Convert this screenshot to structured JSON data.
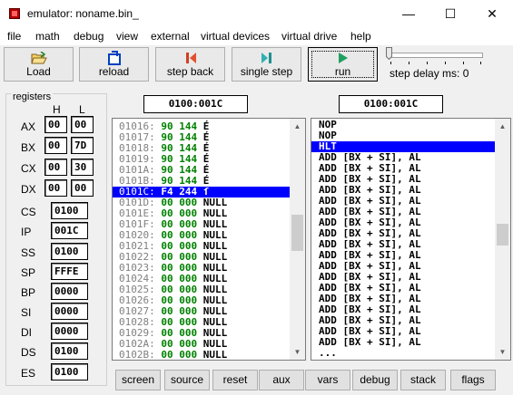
{
  "window": {
    "title": "emulator: noname.bin_",
    "minimize": "—",
    "maximize": "☐",
    "close": "✕"
  },
  "menu": [
    "file",
    "math",
    "debug",
    "view",
    "external",
    "virtual devices",
    "virtual drive",
    "help"
  ],
  "toolbar": {
    "load": "Load",
    "reload": "reload",
    "step_back": "step back",
    "single_step": "single step",
    "run": "run",
    "step_delay": "step delay ms: 0"
  },
  "registers": {
    "title": "registers",
    "h_label": "H",
    "l_label": "L",
    "split": [
      {
        "name": "AX",
        "h": "00",
        "l": "00"
      },
      {
        "name": "BX",
        "h": "00",
        "l": "7D"
      },
      {
        "name": "CX",
        "h": "00",
        "l": "30"
      },
      {
        "name": "DX",
        "h": "00",
        "l": "00"
      }
    ],
    "full": [
      {
        "name": "CS",
        "value": "0100"
      },
      {
        "name": "IP",
        "value": "001C"
      },
      {
        "name": "SS",
        "value": "0100"
      },
      {
        "name": "SP",
        "value": "FFFE"
      },
      {
        "name": "BP",
        "value": "0000"
      },
      {
        "name": "SI",
        "value": "0000"
      },
      {
        "name": "DI",
        "value": "0000"
      },
      {
        "name": "DS",
        "value": "0100"
      },
      {
        "name": "ES",
        "value": "0100"
      }
    ]
  },
  "memory": {
    "address": "0100:001C",
    "rows": [
      {
        "addr": "01016:",
        "hex": "90",
        "dec": "144",
        "ch": "É",
        "sel": false
      },
      {
        "addr": "01017:",
        "hex": "90",
        "dec": "144",
        "ch": "É",
        "sel": false
      },
      {
        "addr": "01018:",
        "hex": "90",
        "dec": "144",
        "ch": "É",
        "sel": false
      },
      {
        "addr": "01019:",
        "hex": "90",
        "dec": "144",
        "ch": "É",
        "sel": false
      },
      {
        "addr": "0101A:",
        "hex": "90",
        "dec": "144",
        "ch": "É",
        "sel": false
      },
      {
        "addr": "0101B:",
        "hex": "90",
        "dec": "144",
        "ch": "É",
        "sel": false
      },
      {
        "addr": "0101C:",
        "hex": "F4",
        "dec": "244",
        "ch": "ſ",
        "sel": true
      },
      {
        "addr": "0101D:",
        "hex": "00",
        "dec": "000",
        "ch": "NULL",
        "sel": false
      },
      {
        "addr": "0101E:",
        "hex": "00",
        "dec": "000",
        "ch": "NULL",
        "sel": false
      },
      {
        "addr": "0101F:",
        "hex": "00",
        "dec": "000",
        "ch": "NULL",
        "sel": false
      },
      {
        "addr": "01020:",
        "hex": "00",
        "dec": "000",
        "ch": "NULL",
        "sel": false
      },
      {
        "addr": "01021:",
        "hex": "00",
        "dec": "000",
        "ch": "NULL",
        "sel": false
      },
      {
        "addr": "01022:",
        "hex": "00",
        "dec": "000",
        "ch": "NULL",
        "sel": false
      },
      {
        "addr": "01023:",
        "hex": "00",
        "dec": "000",
        "ch": "NULL",
        "sel": false
      },
      {
        "addr": "01024:",
        "hex": "00",
        "dec": "000",
        "ch": "NULL",
        "sel": false
      },
      {
        "addr": "01025:",
        "hex": "00",
        "dec": "000",
        "ch": "NULL",
        "sel": false
      },
      {
        "addr": "01026:",
        "hex": "00",
        "dec": "000",
        "ch": "NULL",
        "sel": false
      },
      {
        "addr": "01027:",
        "hex": "00",
        "dec": "000",
        "ch": "NULL",
        "sel": false
      },
      {
        "addr": "01028:",
        "hex": "00",
        "dec": "000",
        "ch": "NULL",
        "sel": false
      },
      {
        "addr": "01029:",
        "hex": "00",
        "dec": "000",
        "ch": "NULL",
        "sel": false
      },
      {
        "addr": "0102A:",
        "hex": "00",
        "dec": "000",
        "ch": "NULL",
        "sel": false
      },
      {
        "addr": "0102B:",
        "hex": "00",
        "dec": "000",
        "ch": "NULL",
        "sel": false
      }
    ]
  },
  "disasm": {
    "address": "0100:001C",
    "rows": [
      {
        "text": "NOP",
        "sel": false
      },
      {
        "text": "NOP",
        "sel": false
      },
      {
        "text": "HLT",
        "sel": true
      },
      {
        "text": "ADD [BX + SI], AL",
        "sel": false
      },
      {
        "text": "ADD [BX + SI], AL",
        "sel": false
      },
      {
        "text": "ADD [BX + SI], AL",
        "sel": false
      },
      {
        "text": "ADD [BX + SI], AL",
        "sel": false
      },
      {
        "text": "ADD [BX + SI], AL",
        "sel": false
      },
      {
        "text": "ADD [BX + SI], AL",
        "sel": false
      },
      {
        "text": "ADD [BX + SI], AL",
        "sel": false
      },
      {
        "text": "ADD [BX + SI], AL",
        "sel": false
      },
      {
        "text": "ADD [BX + SI], AL",
        "sel": false
      },
      {
        "text": "ADD [BX + SI], AL",
        "sel": false
      },
      {
        "text": "ADD [BX + SI], AL",
        "sel": false
      },
      {
        "text": "ADD [BX + SI], AL",
        "sel": false
      },
      {
        "text": "ADD [BX + SI], AL",
        "sel": false
      },
      {
        "text": "ADD [BX + SI], AL",
        "sel": false
      },
      {
        "text": "ADD [BX + SI], AL",
        "sel": false
      },
      {
        "text": "ADD [BX + SI], AL",
        "sel": false
      },
      {
        "text": "ADD [BX + SI], AL",
        "sel": false
      },
      {
        "text": "ADD [BX + SI], AL",
        "sel": false
      },
      {
        "text": "...",
        "sel": false
      }
    ]
  },
  "bottom_buttons": [
    "screen",
    "source",
    "reset",
    "aux",
    "vars",
    "debug",
    "stack",
    "flags"
  ],
  "colors": {
    "selection": "#0000ff",
    "hex_green": "#008000",
    "address_gray": "#808080"
  }
}
